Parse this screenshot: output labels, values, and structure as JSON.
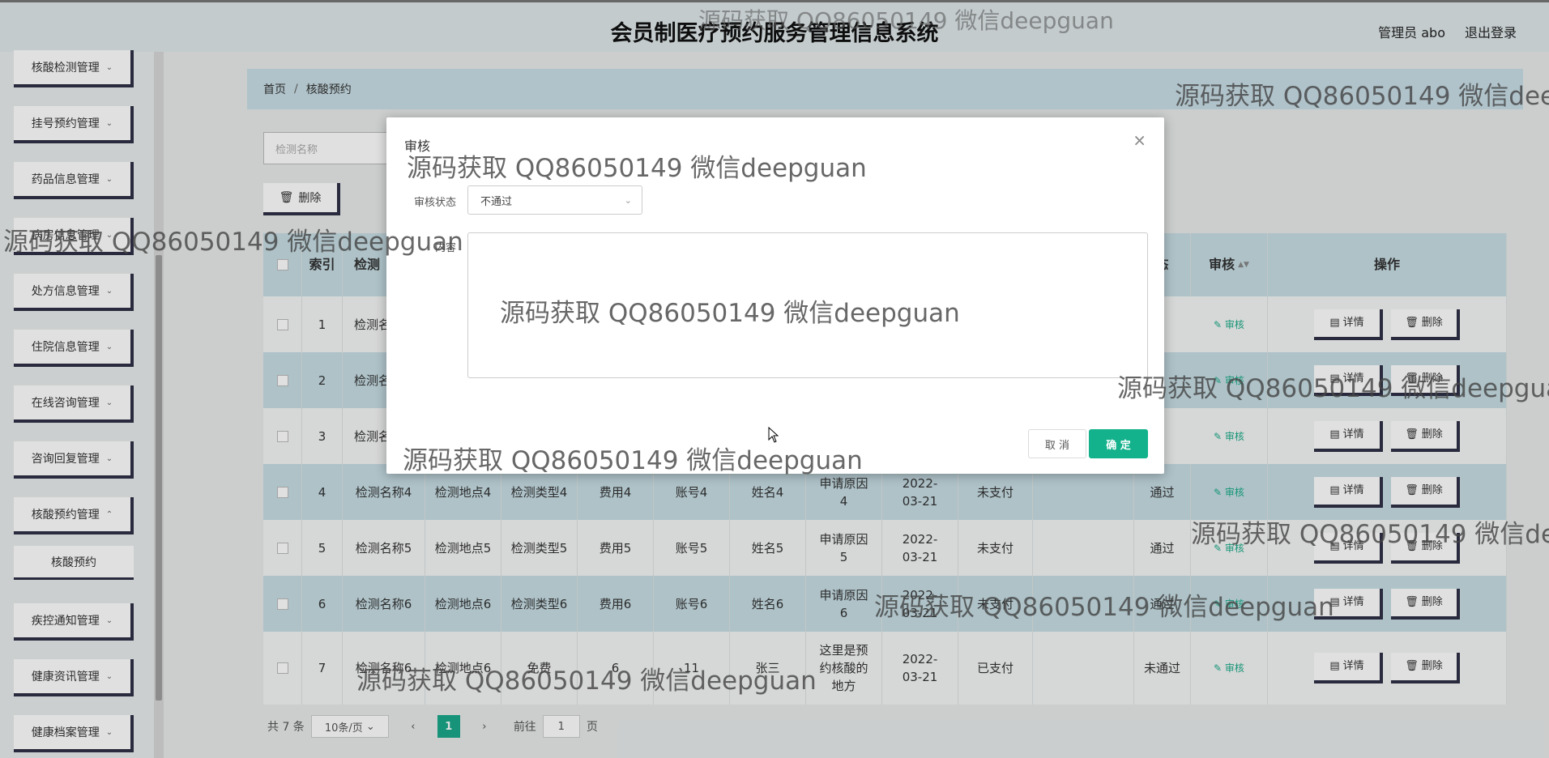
{
  "header": {
    "title": "会员制医疗预约服务管理信息系统",
    "user": "管理员 abo",
    "logout": "退出登录"
  },
  "sidebar": {
    "menus": [
      "核酸检测管理",
      "挂号预约管理",
      "药品信息管理",
      "病房信息管理",
      "处方信息管理",
      "住院信息管理",
      "在线咨询管理",
      "咨询回复管理",
      "核酸预约管理",
      "疾控通知管理",
      "健康资讯管理",
      "健康档案管理"
    ],
    "sub_item": "核酸预约"
  },
  "breadcrumb": {
    "home": "首页",
    "separator": "/",
    "current": "核酸预约"
  },
  "search": {
    "placeholder": "检测名称"
  },
  "toolbar": {
    "delete": "删除"
  },
  "table": {
    "headers": {
      "index": "索引",
      "name": "检测",
      "status": "态",
      "audit": "审核",
      "actions": "操作"
    },
    "rows": [
      {
        "idx": "1",
        "name": "检测名",
        "audit_link": "审核"
      },
      {
        "idx": "2",
        "name": "检测名",
        "audit_link": "审核"
      },
      {
        "idx": "3",
        "name": "检测名",
        "audit_link": "审核"
      },
      {
        "idx": "4",
        "name": "检测名称4",
        "place": "检测地点4",
        "type": "检测类型4",
        "fee": "费用4",
        "account": "账号4",
        "person": "姓名4",
        "reason": "申请原因4",
        "date": "2022-03-21",
        "pay": "未支付",
        "result": "通过",
        "audit_link": "审核"
      },
      {
        "idx": "5",
        "name": "检测名称5",
        "place": "检测地点5",
        "type": "检测类型5",
        "fee": "费用5",
        "account": "账号5",
        "person": "姓名5",
        "reason": "申请原因5",
        "date": "2022-03-21",
        "pay": "未支付",
        "result": "通过",
        "audit_link": "审核"
      },
      {
        "idx": "6",
        "name": "检测名称6",
        "place": "检测地点6",
        "type": "检测类型6",
        "fee": "费用6",
        "account": "账号6",
        "person": "姓名6",
        "reason": "申请原因6",
        "date": "2022-03-21",
        "pay": "未支付",
        "result": "通过",
        "audit_link": "审核"
      },
      {
        "idx": "7",
        "name": "检测名称6",
        "place": "检测地点6",
        "type": "免费",
        "fee": "6",
        "account": "11",
        "person": "张三",
        "reason": "这里是预约核酸的地方",
        "date": "2022-03-21",
        "pay": "已支付",
        "result": "未通过",
        "audit_link": "审核"
      }
    ],
    "detail_label": "详情",
    "delete_label": "删除"
  },
  "pager": {
    "total": "共 7 条",
    "page_size": "10条/页",
    "current_page": "1",
    "goto_prefix": "前往",
    "goto_value": "1",
    "goto_suffix": "页"
  },
  "dialog": {
    "title": "审核",
    "status_label": "审核状态",
    "status_value": "不通过",
    "content_label": "内容",
    "cancel": "取 消",
    "ok": "确 定"
  },
  "watermark": "源码获取 QQ86050149 微信deepguan",
  "colors": {
    "accent": "#13b28c",
    "header_bg": "#dfe7ea",
    "row_alt": "#c6dde4",
    "menu_border": "#2f3046"
  }
}
